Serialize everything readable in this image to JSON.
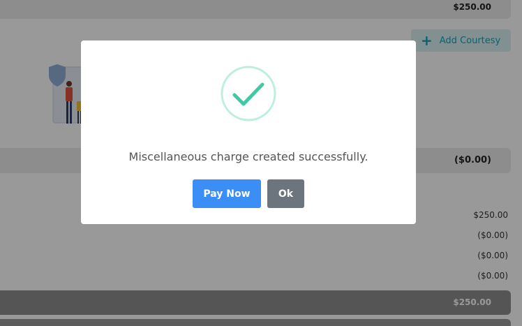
{
  "page": {
    "top_total": "$250.00",
    "add_courtesy_label": "Add Courtesy",
    "discount_amount": "($0.00)",
    "summary_lines": [
      "$250.00",
      "($0.00)",
      "($0.00)",
      "($0.00)"
    ],
    "grand_total": "$250.00"
  },
  "modal": {
    "message": "Miscellaneous charge created successfully.",
    "pay_now_label": "Pay Now",
    "ok_label": "Ok"
  },
  "colors": {
    "primary": "#3b8ef5",
    "secondary": "#6c757d",
    "success": "#3fc9a4",
    "info": "#17a2b8"
  }
}
